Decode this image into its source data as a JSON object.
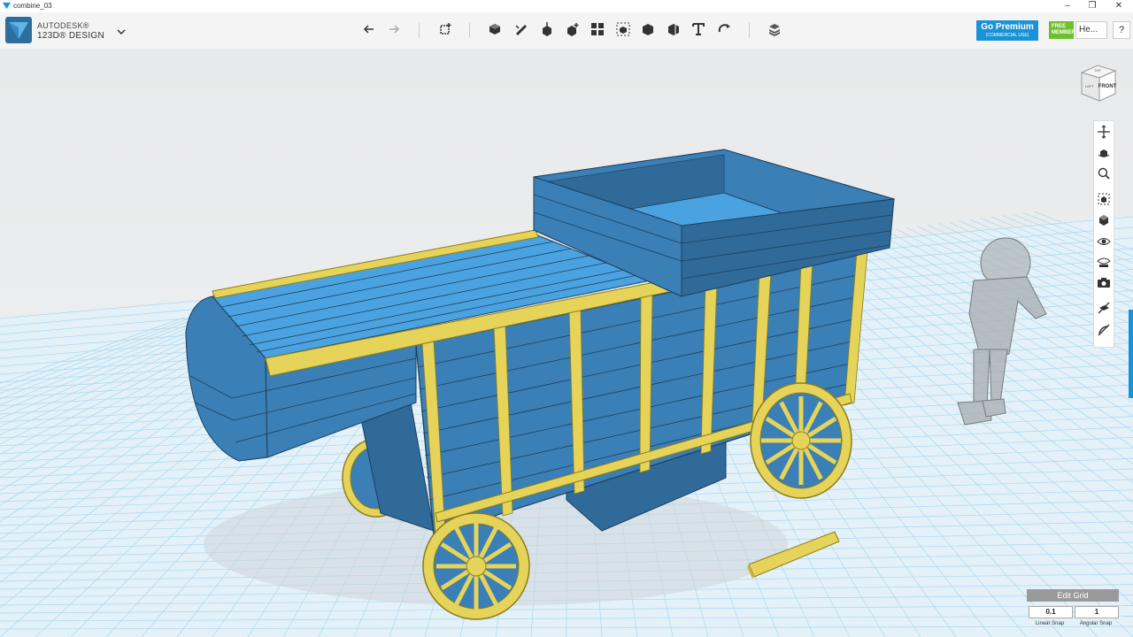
{
  "window": {
    "title": "combine_03",
    "minimize": "–",
    "maximize": "❐",
    "close": "✕"
  },
  "brand": {
    "line1": "AUTODESK®",
    "line2": "123D® DESIGN"
  },
  "toolbar": {
    "icons": [
      "undo-icon",
      "redo-icon",
      "transform-icon",
      "primitives-icon",
      "sketch-icon",
      "construct-icon",
      "modify-icon",
      "pattern-icon",
      "group-icon",
      "combine-icon",
      "measure-icon",
      "text-icon",
      "snap-icon",
      "materials-icon"
    ]
  },
  "premium": {
    "title": "Go Premium",
    "subtitle": "(COMMERCIAL USE)"
  },
  "membership": {
    "line1": "FREE",
    "line2": "MEMBER"
  },
  "user": {
    "label": "He..."
  },
  "help": {
    "label": "?"
  },
  "viewcube": {
    "top": "TOP",
    "left": "LEFT",
    "front": "FRONT"
  },
  "navbar": {
    "icons": [
      "pan-icon",
      "orbit-icon",
      "zoom-icon",
      "fit-icon",
      "view-icon",
      "visibility-icon",
      "materials-view-icon",
      "screenshot-icon",
      "grid-toggle-icon",
      "snap-toggle-icon"
    ]
  },
  "grid": {
    "title": "Edit Grid",
    "linear_value": "0.1",
    "angular_value": "1",
    "linear_label": "Linear Snap",
    "angular_label": "Angular Snap"
  },
  "colors": {
    "body": "#3a7fb5",
    "body_light": "#4aa3e0",
    "trim": "#e6d35a",
    "grid": "#a8d8f0",
    "accent": "#1a92d8"
  }
}
